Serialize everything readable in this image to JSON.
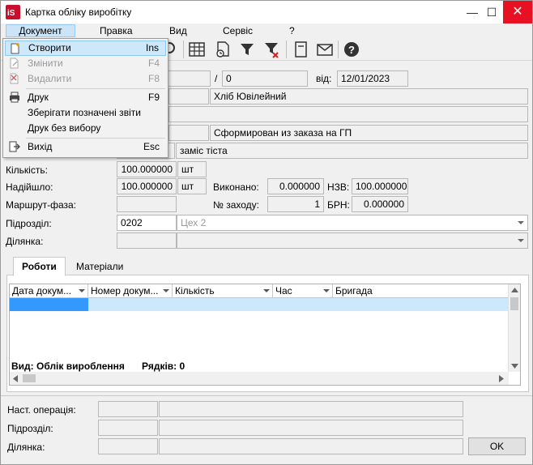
{
  "window": {
    "title": "Картка обліку виробітку",
    "minimize": "—",
    "maximize": "☐",
    "close": "✕"
  },
  "menu": {
    "items": [
      "Документ",
      "Правка",
      "Вид",
      "Сервіс",
      "?"
    ]
  },
  "toolbar": {
    "icons": [
      "search-icon",
      "table-icon",
      "clock-doc-icon",
      "filter-icon",
      "filter-clear-icon",
      "document-icon",
      "mail-icon",
      "help-icon"
    ]
  },
  "dropdown": {
    "items": [
      {
        "label": "Створити",
        "key": "Ins",
        "icon": "new-doc-icon"
      },
      {
        "label": "Змінити",
        "key": "F4",
        "icon": "edit-icon"
      },
      {
        "label": "Видалити",
        "key": "F8",
        "icon": "delete-icon"
      },
      {
        "label": "Друк",
        "key": "F9",
        "icon": "printer-icon"
      },
      {
        "label": "Зберігати позначені звіти",
        "key": "",
        "icon": ""
      },
      {
        "label": "Друк без вибору",
        "key": "",
        "icon": ""
      },
      {
        "label": "Вихід",
        "key": "Esc",
        "icon": "exit-icon"
      }
    ]
  },
  "form": {
    "num_sep": "/",
    "num_value": "0",
    "date_label": "від:",
    "date_value": "12/01/2023",
    "product": "Хліб Ювілейний",
    "basis": "Сформирован из заказа на ГП",
    "operation": "заміс тіста",
    "quantity_label": "Кількість:",
    "quantity_value": "100.000000",
    "quantity_unit": "шт",
    "received_label": "Надійшло:",
    "received_value": "100.000000",
    "received_unit": "шт",
    "done_label": "Виконано:",
    "done_value": "0.000000",
    "nzv_label": "НЗВ:",
    "nzv_value": "100.000000",
    "route_label": "Маршрут-фаза:",
    "run_label": "№ заходу:",
    "run_value": "1",
    "brn_label": "БРН:",
    "brn_value": "0.000000",
    "division_label": "Підрозділ:",
    "division_code": "0202",
    "division_name": "Цех 2",
    "section_label": "Ділянка:"
  },
  "tabs": [
    "Роботи",
    "Матеріали"
  ],
  "grid": {
    "columns": [
      "Дата докум...",
      "Номер докум...",
      "Кількість",
      "Час",
      "Бригада"
    ],
    "status_view": "Вид: Облік вироблення",
    "status_rows": "Рядків: 0"
  },
  "bottom": {
    "next_op_label": "Наст. операція:",
    "division_label": "Підрозділ:",
    "section_label": "Ділянка:",
    "ok_label": "OK"
  }
}
